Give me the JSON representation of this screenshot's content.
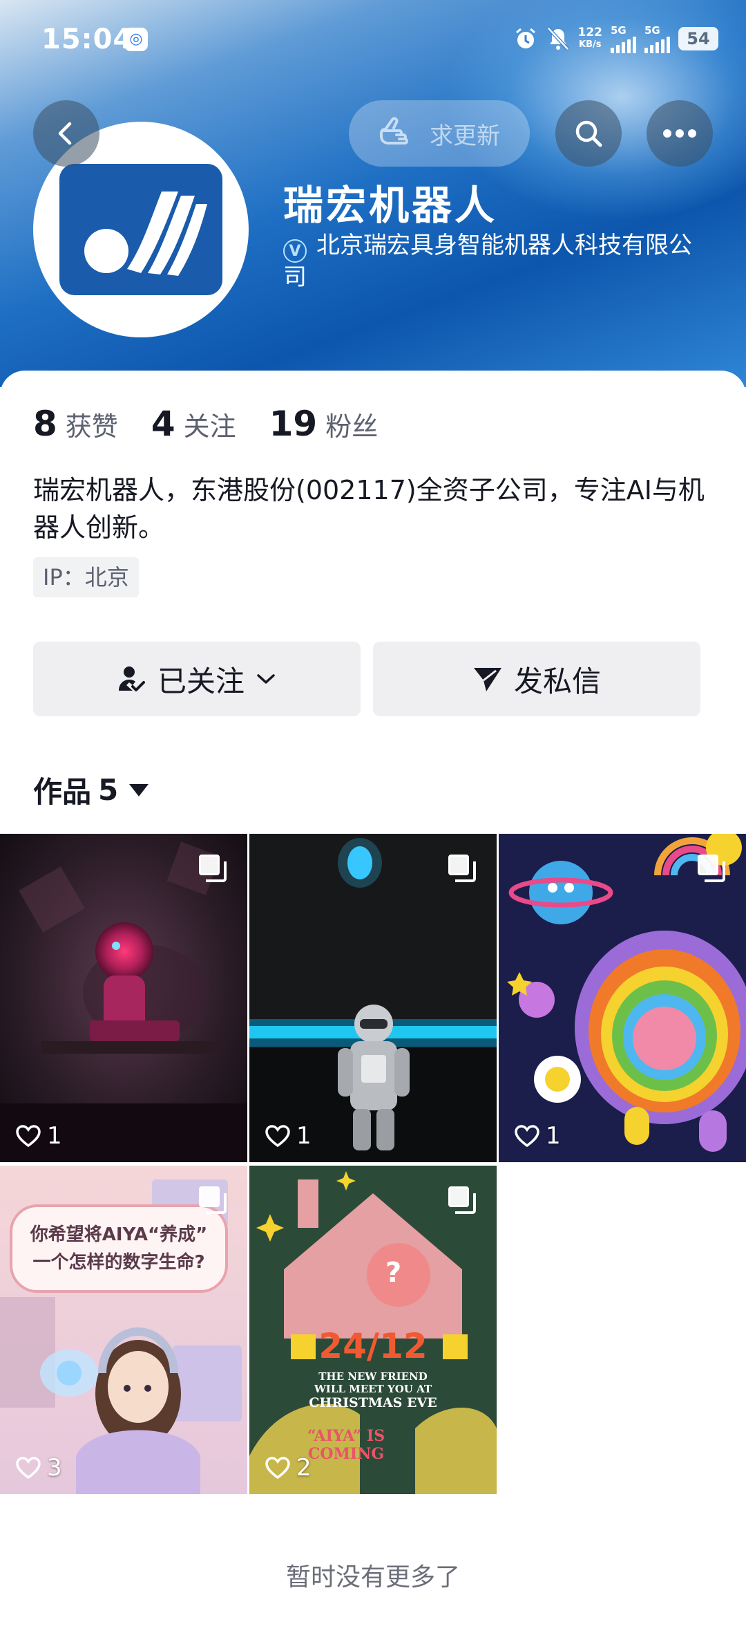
{
  "status_bar": {
    "time": "15:04",
    "speed_value": "122",
    "speed_unit": "KB/s",
    "net1": "5G",
    "net2": "5G",
    "battery": "54"
  },
  "header": {
    "request_update_label": "求更新"
  },
  "profile": {
    "name": "瑞宏机器人",
    "verified_badge": "V",
    "verified_text": "北京瑞宏具身智能机器人科技有限公司"
  },
  "stats": [
    {
      "value": "8",
      "label": "获赞"
    },
    {
      "value": "4",
      "label": "关注"
    },
    {
      "value": "19",
      "label": "粉丝"
    }
  ],
  "bio": "瑞宏机器人，东港股份(002117)全资子公司，专注AI与机器人创新。",
  "ip_tag": "IP：北京",
  "actions": {
    "follow_label": "已关注",
    "message_label": "发私信"
  },
  "works": {
    "title": "作品",
    "count": "5",
    "items": [
      {
        "likes": "1"
      },
      {
        "likes": "1"
      },
      {
        "likes": "1"
      },
      {
        "likes": "3",
        "poster_text_1": "你希望将AIYA“养成”",
        "poster_text_2": "一个怎样的数字生命?"
      },
      {
        "likes": "2",
        "poster_date": "24/12",
        "poster_line_1": "THE NEW FRIEND",
        "poster_line_2": "WILL MEET YOU AT",
        "poster_line_3": "CHRISTMAS EVE",
        "poster_tag": "“AIYA” IS COMING"
      }
    ]
  },
  "footer": {
    "no_more": "暂时没有更多了"
  },
  "colors": {
    "header_blue": "#1e6fc4",
    "button_bg": "#efeff1",
    "text_primary": "#161823",
    "text_secondary": "#5c6070"
  }
}
